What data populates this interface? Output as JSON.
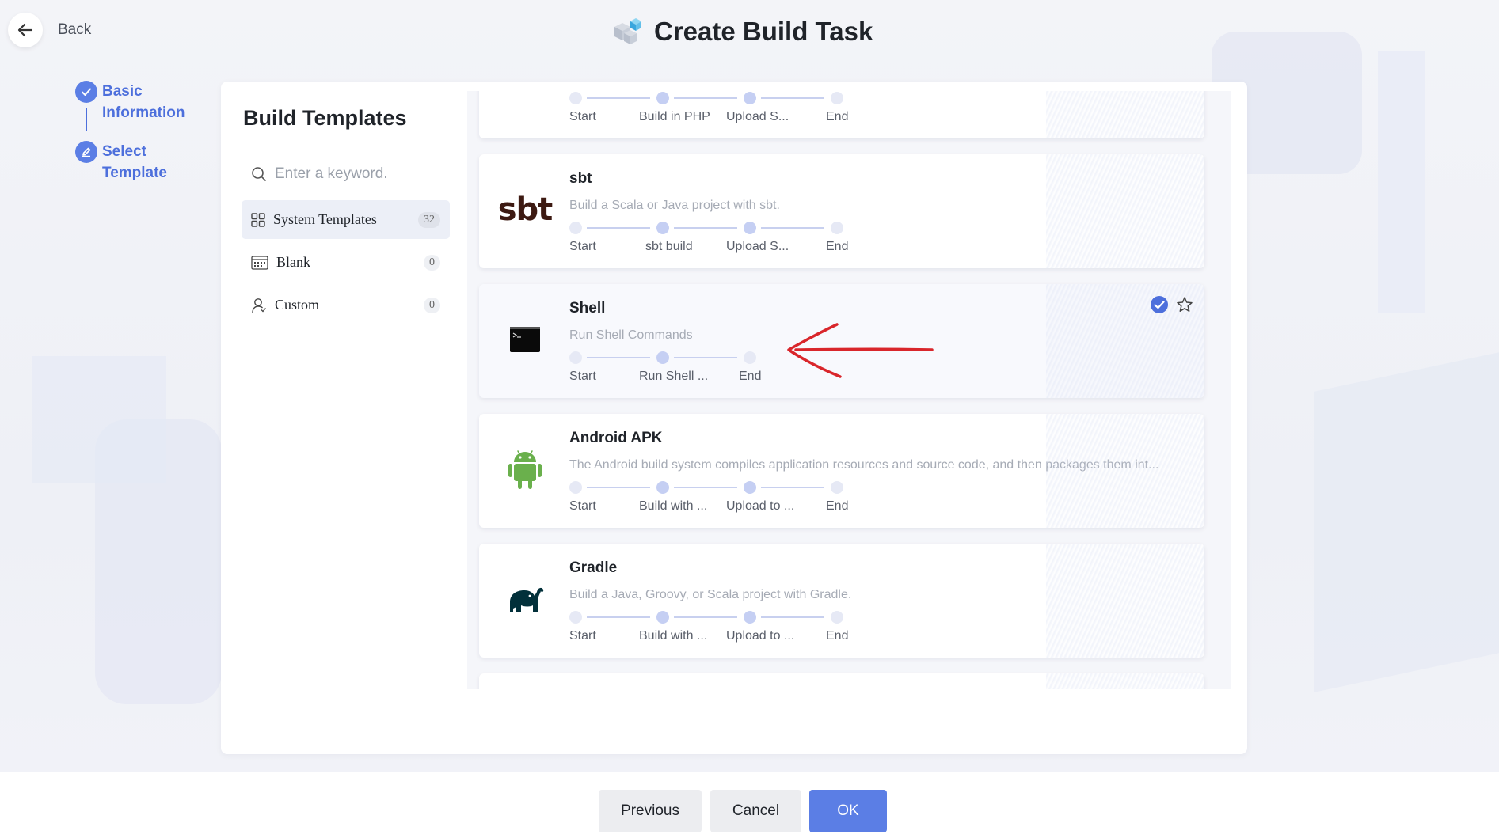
{
  "header": {
    "back_label": "Back",
    "title": "Create Build Task"
  },
  "steps": [
    {
      "line1": "Basic",
      "line2": "Information",
      "status": "done"
    },
    {
      "line1": "Select",
      "line2": "Template",
      "status": "current"
    }
  ],
  "sidebar": {
    "title": "Build Templates",
    "search_placeholder": "Enter a keyword.",
    "categories": [
      {
        "label": "System Templates",
        "count": "32",
        "active": true,
        "icon": "grid-icon"
      },
      {
        "label": "Blank",
        "count": "0",
        "active": false,
        "icon": "calendar-grid-icon"
      },
      {
        "label": "Custom",
        "count": "0",
        "active": false,
        "icon": "user-icon"
      }
    ]
  },
  "templates": [
    {
      "name": "",
      "description": "",
      "steps": [
        "Start",
        "Build in PHP",
        "Upload S...",
        "End"
      ],
      "partial": true
    },
    {
      "name": "sbt",
      "logo_text": "sbt",
      "description": "Build a Scala or Java project with sbt.",
      "steps": [
        "Start",
        "sbt build",
        "Upload S...",
        "End"
      ]
    },
    {
      "name": "Shell",
      "description": "Run Shell Commands",
      "steps": [
        "Start",
        "Run Shell ...",
        "End"
      ],
      "selected": true
    },
    {
      "name": "Android APK",
      "description": "The Android build system compiles application resources and source code, and then packages them int...",
      "steps": [
        "Start",
        "Build with ...",
        "Upload to ...",
        "End"
      ]
    },
    {
      "name": "Gradle",
      "description": "Build a Java, Groovy, or Scala project with Gradle.",
      "steps": [
        "Start",
        "Build with ...",
        "Upload to ...",
        "End"
      ]
    }
  ],
  "footer": {
    "previous_label": "Previous",
    "cancel_label": "Cancel",
    "ok_label": "OK"
  },
  "colors": {
    "accent": "#5b7ee5",
    "annotation": "#d9262b",
    "android": "#6ab04c",
    "gradle": "#02303a",
    "sbt": "#3d1a12"
  }
}
